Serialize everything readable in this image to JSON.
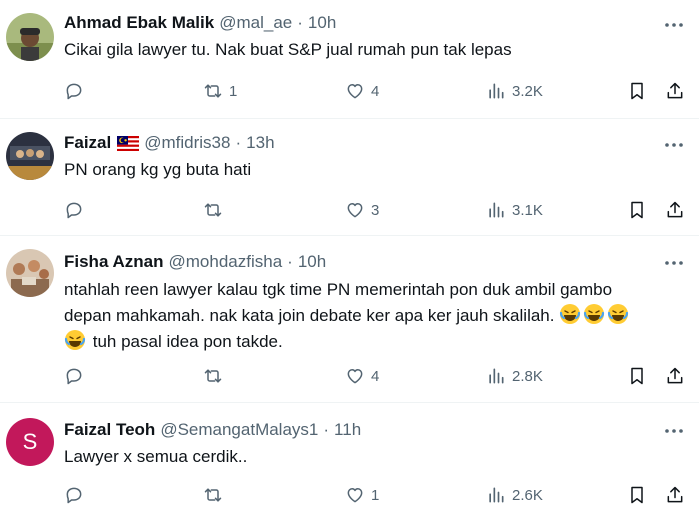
{
  "tweets": [
    {
      "name": "Ahmad Ebak Malik",
      "handle": "@mal_ae",
      "dot": "·",
      "time": "10h",
      "text": "Cikai gila lawyer tu. Nak buat S&P jual rumah pun tak lepas",
      "replies": "",
      "retweets": "1",
      "likes": "4",
      "views": "3.2K"
    },
    {
      "name": "Faizal",
      "handle": "@mfidris38",
      "dot": "·",
      "time": "13h",
      "text": "PN orang kg yg buta hati",
      "replies": "",
      "retweets": "",
      "likes": "3",
      "views": "3.1K"
    },
    {
      "name": "Fisha Aznan",
      "handle": "@mohdazfisha",
      "dot": "·",
      "time": "10h",
      "text_line1": "ntahlah reen lawyer kalau tgk time PN memerintah pon duk ambil gambo",
      "text_line2": "depan mahkamah. nak kata join debate ker apa ker jauh skalilah.",
      "text_line3": "tuh pasal idea pon takde.",
      "replies": "",
      "retweets": "",
      "likes": "4",
      "views": "2.8K"
    },
    {
      "name": "Faizal Teoh",
      "handle": "@SemangatMalays1",
      "dot": "·",
      "time": "11h",
      "text": "Lawyer x semua cerdik..",
      "avatar_letter": "S",
      "replies": "",
      "retweets": "",
      "likes": "1",
      "views": "2.6K"
    }
  ],
  "colors": {
    "text": "#0f1419",
    "secondary": "#536471",
    "divider": "#eff3f4",
    "avatar_s": "#c2185b"
  }
}
